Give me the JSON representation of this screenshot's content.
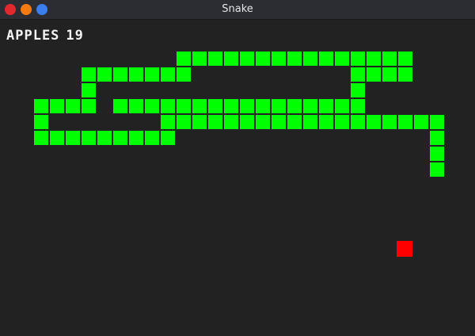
{
  "window": {
    "title": "Snake"
  },
  "hud": {
    "apples_label": "APPLES",
    "apples_count": "19"
  },
  "colors": {
    "snake": "#00ff00",
    "apple": "#ff0000",
    "background": "#222222"
  },
  "snake": {
    "cells": [
      [
        11,
        3
      ],
      [
        12,
        3
      ],
      [
        13,
        3
      ],
      [
        14,
        3
      ],
      [
        15,
        3
      ],
      [
        16,
        3
      ],
      [
        17,
        3
      ],
      [
        18,
        3
      ],
      [
        19,
        3
      ],
      [
        20,
        3
      ],
      [
        21,
        3
      ],
      [
        22,
        3
      ],
      [
        23,
        3
      ],
      [
        24,
        3
      ],
      [
        25,
        3
      ],
      [
        5,
        4
      ],
      [
        6,
        4
      ],
      [
        7,
        4
      ],
      [
        8,
        4
      ],
      [
        9,
        4
      ],
      [
        10,
        4
      ],
      [
        11,
        4
      ],
      [
        22,
        4
      ],
      [
        23,
        4
      ],
      [
        24,
        4
      ],
      [
        25,
        4
      ],
      [
        5,
        5
      ],
      [
        22,
        5
      ],
      [
        2,
        6
      ],
      [
        3,
        6
      ],
      [
        4,
        6
      ],
      [
        5,
        6
      ],
      [
        7,
        6
      ],
      [
        8,
        6
      ],
      [
        9,
        6
      ],
      [
        10,
        6
      ],
      [
        11,
        6
      ],
      [
        12,
        6
      ],
      [
        13,
        6
      ],
      [
        14,
        6
      ],
      [
        15,
        6
      ],
      [
        16,
        6
      ],
      [
        17,
        6
      ],
      [
        18,
        6
      ],
      [
        19,
        6
      ],
      [
        20,
        6
      ],
      [
        21,
        6
      ],
      [
        22,
        6
      ],
      [
        2,
        7
      ],
      [
        10,
        7
      ],
      [
        11,
        7
      ],
      [
        12,
        7
      ],
      [
        13,
        7
      ],
      [
        14,
        7
      ],
      [
        15,
        7
      ],
      [
        16,
        7
      ],
      [
        17,
        7
      ],
      [
        18,
        7
      ],
      [
        19,
        7
      ],
      [
        20,
        7
      ],
      [
        21,
        7
      ],
      [
        22,
        7
      ],
      [
        23,
        7
      ],
      [
        24,
        7
      ],
      [
        25,
        7
      ],
      [
        26,
        7
      ],
      [
        27,
        7
      ],
      [
        2,
        8
      ],
      [
        3,
        8
      ],
      [
        4,
        8
      ],
      [
        5,
        8
      ],
      [
        6,
        8
      ],
      [
        7,
        8
      ],
      [
        8,
        8
      ],
      [
        9,
        8
      ],
      [
        10,
        8
      ],
      [
        27,
        8
      ],
      [
        27,
        9
      ],
      [
        27,
        10
      ]
    ]
  },
  "apple": {
    "cell": [
      25,
      15
    ]
  }
}
